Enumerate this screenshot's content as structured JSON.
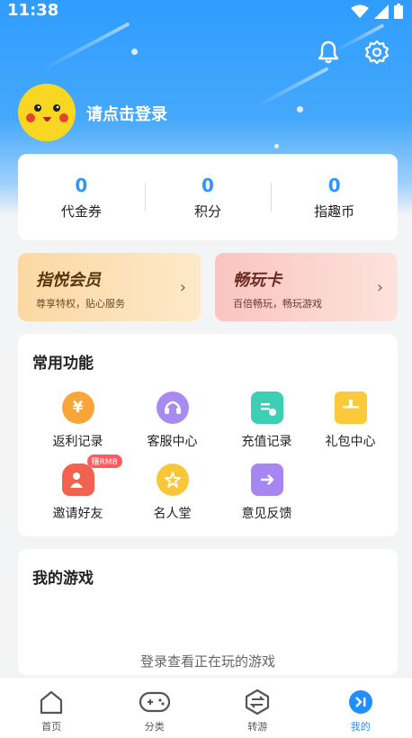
{
  "status_bar": {
    "time": "11:38"
  },
  "header": {
    "login_prompt": "请点击登录"
  },
  "stats": [
    {
      "value": "0",
      "label": "代金券"
    },
    {
      "value": "0",
      "label": "积分"
    },
    {
      "value": "0",
      "label": "指趣币"
    }
  ],
  "promos": {
    "vip": {
      "title": "指悦会员",
      "subtitle": "尊享特权，贴心服务"
    },
    "card": {
      "title": "畅玩卡",
      "subtitle": "百倍畅玩，畅玩游戏"
    }
  },
  "functions": {
    "title": "常用功能",
    "items": [
      {
        "label": "返利记录",
        "icon": "rebate-icon"
      },
      {
        "label": "客服中心",
        "icon": "headset-icon"
      },
      {
        "label": "充值记录",
        "icon": "recharge-icon"
      },
      {
        "label": "礼包中心",
        "icon": "gift-icon"
      },
      {
        "label": "邀请好友",
        "icon": "invite-icon",
        "badge": "赚RMB"
      },
      {
        "label": "名人堂",
        "icon": "star-icon"
      },
      {
        "label": "意见反馈",
        "icon": "feedback-icon"
      }
    ]
  },
  "games": {
    "title": "我的游戏",
    "empty_text": "登录查看正在玩的游戏"
  },
  "tabs": [
    {
      "label": "首页",
      "icon": "home-icon"
    },
    {
      "label": "分类",
      "icon": "gamepad-icon"
    },
    {
      "label": "转游",
      "icon": "switch-icon"
    },
    {
      "label": "我的",
      "icon": "profile-icon",
      "active": true
    }
  ],
  "colors": {
    "accent": "#2f96ff",
    "header": "#45a8fb"
  }
}
